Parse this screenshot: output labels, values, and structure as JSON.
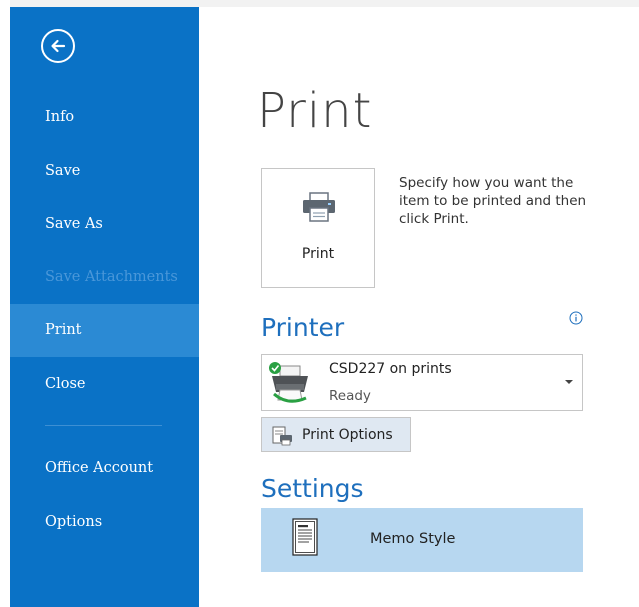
{
  "sidebar": {
    "back_icon": "back-arrow-icon",
    "items": [
      {
        "label": "Info"
      },
      {
        "label": "Save"
      },
      {
        "label": "Save As"
      },
      {
        "label": "Save Attachments",
        "disabled": true
      },
      {
        "label": "Print",
        "active": true
      },
      {
        "label": "Close"
      },
      {
        "label": "Office Account"
      },
      {
        "label": "Options"
      }
    ]
  },
  "main": {
    "title": "Print",
    "print_button": {
      "label": "Print",
      "icon": "printer-icon"
    },
    "description": "Specify how you want the item to be printed and then click Print.",
    "printer_section": {
      "title": "Printer",
      "info_icon": "info-icon",
      "selected_printer": {
        "name": "CSD227 on prints",
        "status": "Ready"
      }
    },
    "print_options_label": "Print Options",
    "settings_section": {
      "title": "Settings",
      "style": {
        "label": "Memo Style",
        "icon": "memo-style-icon"
      }
    }
  },
  "colors": {
    "sidebar_bg": "#0a72c6",
    "sidebar_active": "#2b8ad4",
    "accent_title": "#1e6fbd",
    "selected_style_bg": "#b7d7f0"
  }
}
